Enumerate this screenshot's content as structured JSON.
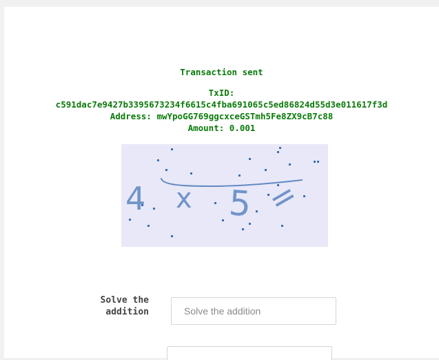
{
  "transaction": {
    "title": "Transaction sent",
    "txid_label": "TxID:",
    "txid": "c591dac7e9427b3395673234f6615c4fba691065c5ed86824d55d3e011617f3d",
    "address_label": "Address:",
    "address": "mwYpoGG769ggcxceGSTmh5Fe8ZX9cB7c88",
    "amount_label": "Amount:",
    "amount": "0.001"
  },
  "captcha": {
    "expression": "4 x 5 ="
  },
  "form": {
    "addition_label": "Solve the addition",
    "addition_placeholder": "Solve the addition",
    "addition_value": ""
  },
  "colors": {
    "success_text": "#0a7a0a",
    "captcha_bg": "#e8e8f8",
    "captcha_ink": "#4a78b8"
  }
}
